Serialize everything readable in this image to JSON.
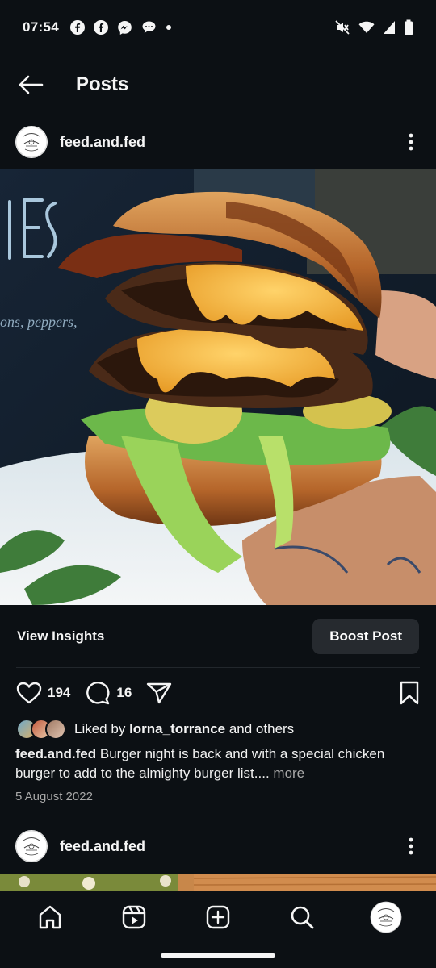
{
  "status_bar": {
    "time": "07:54",
    "left_icons": [
      "facebook-icon",
      "facebook-icon",
      "messenger-icon",
      "chat-bubble-icon",
      "dot-icon"
    ],
    "right_icons": [
      "mute-icon",
      "wifi-icon",
      "signal-icon",
      "battery-icon"
    ]
  },
  "header": {
    "title": "Posts",
    "back_icon": "arrow-left-icon"
  },
  "post": {
    "username": "feed.and.fed",
    "image_alt": "burger",
    "insights_label": "View Insights",
    "boost_label": "Boost Post",
    "like_count": "194",
    "comment_count": "16",
    "liked_by_prefix": "Liked by",
    "liked_by_user": "lorna_torrance",
    "liked_by_suffix": "and others",
    "caption_user": "feed.and.fed",
    "caption_text": "Burger night is back and with a special chicken burger to add to the almighty burger list....",
    "caption_more": "more",
    "date": "5 August 2022"
  },
  "next_post": {
    "username": "feed.and.fed"
  },
  "bottom_nav": {
    "items": [
      "home-icon",
      "reels-icon",
      "create-icon",
      "search-icon",
      "profile-avatar"
    ]
  },
  "colors": {
    "background": "#0c1014",
    "button_bg": "#262a2f",
    "muted_text": "#a8a8a8"
  }
}
